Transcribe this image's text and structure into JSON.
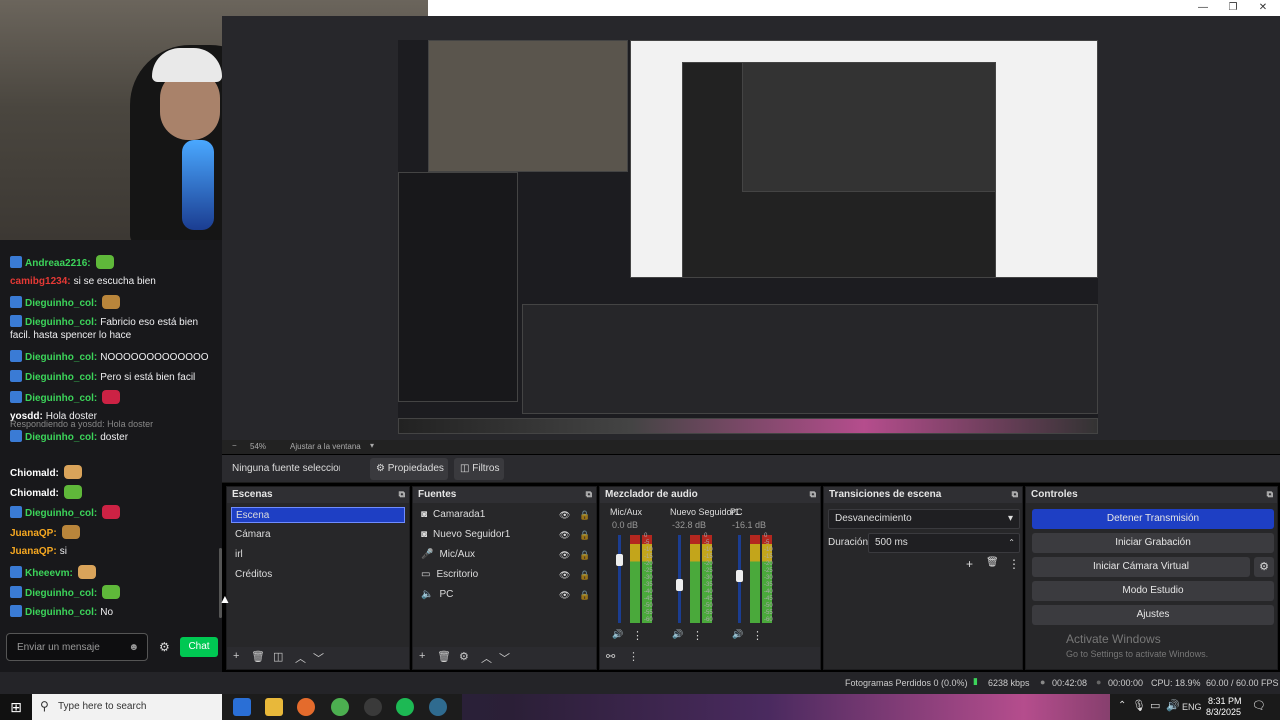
{
  "window": {
    "minimize": "—",
    "maximize": "❐",
    "close": "✕"
  },
  "chat": {
    "messages": [
      {
        "user": "Andreaa2216:",
        "text": "",
        "user_color": "#3cd45a"
      },
      {
        "user": "camibg1234:",
        "text": "si se escucha bien",
        "user_color": "#e53935"
      },
      {
        "user": "Dieguinho_col:",
        "text": "",
        "user_color": "#3cd45a"
      },
      {
        "user": "Dieguinho_col:",
        "text": "Fabricio eso está bien facil. hasta spencer lo hace",
        "user_color": "#3cd45a"
      },
      {
        "user": "Dieguinho_col:",
        "text": "NOOOOOOOOOOOOO",
        "user_color": "#3cd45a"
      },
      {
        "user": "Dieguinho_col:",
        "text": "Pero si está bien facil",
        "user_color": "#3cd45a"
      },
      {
        "user": "Dieguinho_col:",
        "text": "",
        "user_color": "#3cd45a"
      },
      {
        "user": "yosdd:",
        "text": "Hola doster",
        "user_color": "#ffffff"
      },
      {
        "user": "Dieguinho_col:",
        "text": "doster",
        "user_color": "#3cd45a",
        "reply": "Respondiendo a yosdd: Hola doster"
      },
      {
        "user": "Chiomald:",
        "text": "",
        "user_color": "#ffffff"
      },
      {
        "user": "Chiomald:",
        "text": "",
        "user_color": "#ffffff"
      },
      {
        "user": "Dieguinho_col:",
        "text": "",
        "user_color": "#3cd45a"
      },
      {
        "user": "JuanaQP:",
        "text": "",
        "user_color": "#f6a821"
      },
      {
        "user": "JuanaQP:",
        "text": "si",
        "user_color": "#f6a821"
      },
      {
        "user": "Kheeevm:",
        "text": "",
        "user_color": "#3cd45a"
      },
      {
        "user": "Dieguinho_col:",
        "text": "",
        "user_color": "#3cd45a"
      },
      {
        "user": "Dieguinho_col:",
        "text": "No",
        "user_color": "#3cd45a"
      }
    ],
    "input_placeholder": "Enviar un mensaje",
    "send_label": "Chat"
  },
  "preview": {
    "zoom": "54%",
    "fit_label": "Ajustar a la ventana"
  },
  "source_bar": {
    "no_source": "Ninguna fuente seleccionada",
    "properties": "Propiedades",
    "filters": "Filtros"
  },
  "scenes": {
    "title": "Escenas",
    "items": [
      "Escena",
      "Cámara",
      "irl",
      "Créditos"
    ]
  },
  "sources": {
    "title": "Fuentes",
    "items": [
      {
        "label": "Camarada1",
        "icon": "camera-icon"
      },
      {
        "label": "Nuevo Seguidor1",
        "icon": "camera-icon"
      },
      {
        "label": "Mic/Aux",
        "icon": "mic-icon"
      },
      {
        "label": "Escritorio",
        "icon": "monitor-icon"
      },
      {
        "label": "PC",
        "icon": "speaker-icon"
      }
    ]
  },
  "mixer": {
    "title": "Mezclador de audio",
    "channels": [
      {
        "name": "Mic/Aux",
        "db": "0.0 dB",
        "level": 0.78
      },
      {
        "name": "Nuevo Seguidor1",
        "db": "-32.8 dB",
        "level": 0.5
      },
      {
        "name": "PC",
        "db": "-16.1 dB",
        "level": 0.6
      }
    ],
    "scale": [
      "0",
      "-5",
      "-10",
      "-15",
      "-20",
      "-25",
      "-30",
      "-35",
      "-40",
      "-45",
      "-50",
      "-55",
      "-60"
    ]
  },
  "transitions": {
    "title": "Transiciones de escena",
    "selected": "Desvanecimiento",
    "duration_label": "Duración",
    "duration_value": "500 ms"
  },
  "controls": {
    "title": "Controles",
    "buttons": [
      "Detener Transmisión",
      "Iniciar Grabación",
      "Iniciar Cámara Virtual",
      "Modo Estudio",
      "Ajustes"
    ],
    "activate_title": "Activate Windows",
    "activate_sub": "Go to Settings to activate Windows."
  },
  "status": {
    "dropped": "Fotogramas Perdidos 0 (0.0%)",
    "bitrate": "6238 kbps",
    "live_time": "00:42:08",
    "rec_time": "00:00:00",
    "cpu": "CPU: 18.9%",
    "fps": "60.00 / 60.00 FPS"
  },
  "taskbar": {
    "search_placeholder": "Type here to search",
    "lang": "ENG",
    "time": "8:31 PM",
    "date": "8/3/2025"
  },
  "colors": {
    "accent": "#1e3fc4",
    "chat_button": "#00c853",
    "stop_stream": "#1e3fc4"
  }
}
